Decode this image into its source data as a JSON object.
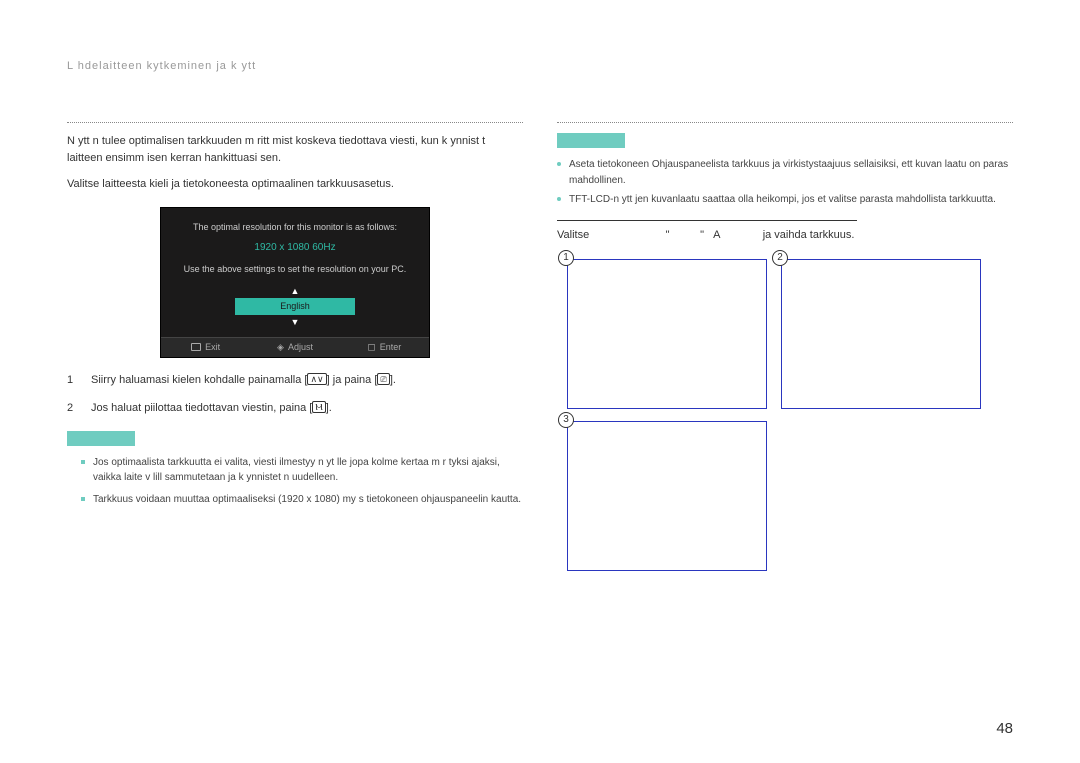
{
  "header": {
    "title": "L hdelaitteen kytkeminen ja k ytt"
  },
  "left": {
    "intro1": "N ytt n tulee optimalisen tarkkuuden m ritt mist  koskeva tiedottava viesti, kun k ynnist t laitteen ensimm isen kerran hankittuasi sen.",
    "intro2": "Valitse laitteesta kieli ja tietokoneesta optimaalinen tarkkuusasetus.",
    "osd": {
      "line1": "The optimal resolution for this monitor is as follows:",
      "resolution": "1920 x 1080 60Hz",
      "line2": "Use the above settings to set the resolution on your PC.",
      "language": "English",
      "bar": {
        "exit": "Exit",
        "adjust": "Adjust",
        "enter": "Enter"
      }
    },
    "steps": [
      {
        "num": "1",
        "text_pre": "Siirry haluamasi kielen kohdalle painamalla [",
        "text_mid": "] ja paina [",
        "text_post": "]."
      },
      {
        "num": "2",
        "text_pre": "Jos haluat piilottaa tiedottavan viestin, paina [",
        "text_post": "]."
      }
    ],
    "note": {
      "b1": "Jos optimaalista tarkkuutta ei valita, viesti ilmestyy n yt lle jopa kolme kertaa m r tyksi ajaksi, vaikka laite v lill  sammutetaan ja k ynnistet n uudelleen.",
      "b2": "Tarkkuus voidaan muuttaa optimaaliseksi (1920 x 1080) my s tietokoneen ohjauspaneelin kautta."
    }
  },
  "right": {
    "note": {
      "a1": "Aseta tietokoneen Ohjauspaneelista tarkkuus ja virkistystaajuus sellaisiksi, ett  kuvan laatu on paras mahdollinen.",
      "a2": "TFT-LCD-n ytt jen kuvanlaatu saattaa olla heikompi, jos et valitse parasta mahdollista tarkkuutta."
    },
    "valitse": {
      "pre": "Valitse",
      "q1": "\"",
      "q2": "\"",
      "a": "A",
      "post": "ja vaihda tarkkuus."
    },
    "images": {
      "n1": "1",
      "n2": "2",
      "n3": "3"
    }
  },
  "page_number": "48"
}
